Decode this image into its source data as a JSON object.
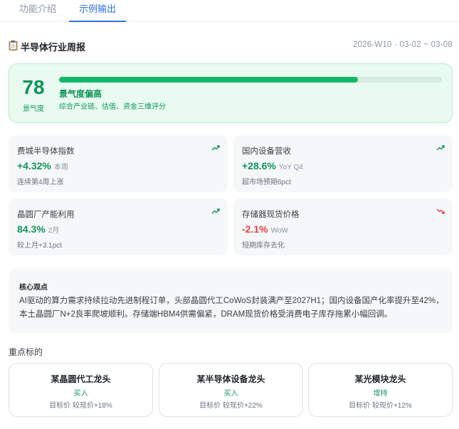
{
  "tabs": [
    {
      "label": "功能介绍",
      "active": false
    },
    {
      "label": "示例输出",
      "active": true
    }
  ],
  "header": {
    "icon": "clipboard-icon",
    "title": "半导体行业周报",
    "range": "2026-W10 · 03-02 ~ 03-08"
  },
  "hero": {
    "score": "78",
    "score_label": "景气度",
    "progress_fraction": 0.78,
    "status": "景气度偏高",
    "subtitle": "综合产业链、估值、资金三维评分"
  },
  "metrics": [
    {
      "title": "费城半导体指数",
      "value": "+4.32%",
      "unit": "本周",
      "note": "连续第4周上涨",
      "trend": "up"
    },
    {
      "title": "国内设备营收",
      "value": "+28.6%",
      "unit": "YoY Q4",
      "note": "超市场预期6pct",
      "trend": "up"
    },
    {
      "title": "晶圆厂产能利用",
      "value": "84.3%",
      "unit": "2月",
      "note": "较上月+3.1pct",
      "trend": "up"
    },
    {
      "title": "存储器现货价格",
      "value": "-2.1%",
      "unit": "WoW",
      "note": "短期库存去化",
      "trend": "down"
    }
  ],
  "view": {
    "title": "核心观点",
    "text": "AI驱动的算力需求持续拉动先进制程订单，头部晶圆代工CoWoS封装满产至2027H1；国内设备国产化率提升至42%，本土晶圆厂N+2良率爬坡顺利。存储端HBM4供需偏紧，DRAM现货价格受消费电子库存拖累小幅回调。"
  },
  "section_label": "重点标的",
  "stocks": [
    {
      "name": "某晶圆代工龙头",
      "rating": "买入",
      "target": "目标价 较现价+18%"
    },
    {
      "name": "某半导体设备龙头",
      "rating": "买入",
      "target": "目标价 较现价+22%"
    },
    {
      "name": "某光模块龙头",
      "rating": "增持",
      "target": "目标价 较现价+12%"
    }
  ],
  "colors": {
    "accent_blue": "#2f6fe4",
    "up_green": "#10935a",
    "down_red": "#e53e3e"
  }
}
